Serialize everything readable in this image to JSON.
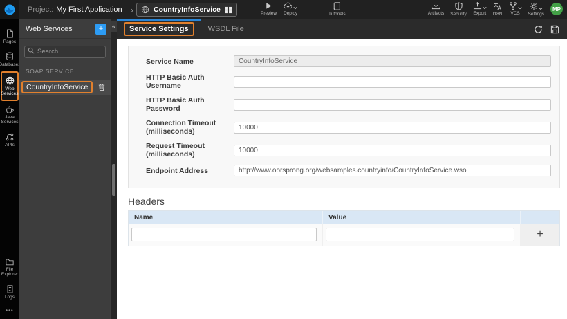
{
  "header": {
    "project_label": "Project:",
    "project_name": "My First Application",
    "breadcrumb_chevron": "›",
    "service_selector": {
      "name": "CountryInfoService"
    },
    "actions": {
      "preview": "Preview",
      "deploy": "Deploy",
      "tutorials": "Tutorials",
      "artifacts": "Artifacts",
      "security": "Security",
      "export": "Export",
      "i18n": "I18N",
      "vcs": "VCS",
      "settings": "Settings"
    },
    "avatar_initials": "MP"
  },
  "left_rail": {
    "items": [
      {
        "label": "Pages"
      },
      {
        "label": "Databases"
      },
      {
        "label": "Web Services"
      },
      {
        "label": "Java Services"
      },
      {
        "label": "APIs"
      }
    ],
    "bottom_items": [
      {
        "label": "File Explorer"
      },
      {
        "label": "Logs"
      }
    ],
    "more_glyph": "•••"
  },
  "sidebar": {
    "title": "Web Services",
    "add_button": "+",
    "search_placeholder": "Search...",
    "section_label": "SOAP SERVICE",
    "items": [
      {
        "label": "CountryInfoService"
      }
    ],
    "collapse_glyph": "«"
  },
  "tabs": [
    {
      "label": "Service Settings",
      "active": true
    },
    {
      "label": "WSDL File",
      "active": false
    }
  ],
  "form": {
    "fields": [
      {
        "label": "Service Name",
        "value": "CountryInfoService",
        "disabled": true
      },
      {
        "label": "HTTP Basic Auth Username",
        "value": ""
      },
      {
        "label": "HTTP Basic Auth Password",
        "value": ""
      },
      {
        "label": "Connection Timeout (milliseconds)",
        "value": "10000"
      },
      {
        "label": "Request Timeout (milliseconds)",
        "value": "10000"
      },
      {
        "label": "Endpoint Address",
        "value": "http://www.oorsprong.org/websamples.countryinfo/CountryInfoService.wso"
      }
    ]
  },
  "headers_section": {
    "title": "Headers",
    "columns": {
      "name": "Name",
      "value": "Value"
    },
    "add_button": "+",
    "row": {
      "name": "",
      "value": ""
    }
  },
  "colors": {
    "annotation_orange": "#e1802d",
    "accent_blue": "#2d9cf4",
    "tab_indicator_blue": "#2b87d8",
    "avatar_green": "#43a047",
    "table_header_blue": "#d9e7f5"
  }
}
